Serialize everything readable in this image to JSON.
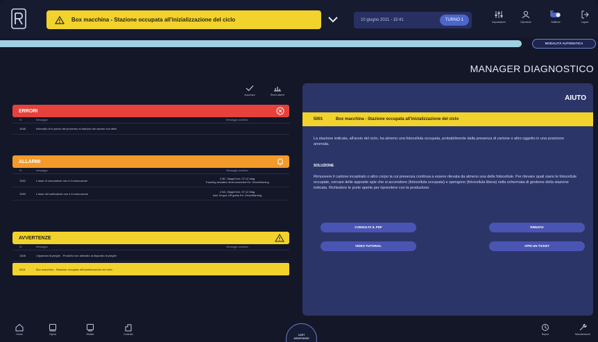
{
  "header": {
    "alert": "Box macchina - Stazione occupata all'inizializzazione del ciclo",
    "date": "10 giugno 2021 - 15:41",
    "shift": "TURNO 1",
    "icons": [
      {
        "label": "Impostazioni",
        "icon": "settings-sliders-icon"
      },
      {
        "label": "Operatore",
        "icon": "user-icon"
      },
      {
        "label": "Notifiche",
        "icon": "notification-toggle-icon"
      },
      {
        "label": "Logout",
        "icon": "logout-icon"
      }
    ]
  },
  "mode_button": "MODALITÀ AUTOMATICA",
  "page_title": "MANAGER DIAGNOSTICO",
  "toolbar": {
    "acknowledge": "Acquisisci",
    "reset": "Reset allarmi"
  },
  "columns": {
    "id": "ID",
    "message": "Messaggio",
    "component": "Messaggio ausiliario"
  },
  "errors": {
    "title": "ERRORI",
    "color": "#e6413a",
    "rows": [
      {
        "id": "1548",
        "message": "Intervallo di lo pezzo del prossimo al trascina nel cartoni non attivi",
        "component": ""
      }
    ]
  },
  "alarms": {
    "title": "ALLARMI",
    "color": "#f39a2a",
    "rows": [
      {
        "id": "1552",
        "message": "L'asse di convoiatore non è in esecuzione",
        "component": "2.9E, StageOver, 07:12 Mag\nTracking deviation limit exceeded Err. DriveWarning"
      },
      {
        "id": "1583",
        "message": "L'asse del sollevatore non è in esecuzione",
        "component": "2.9A, StageOver, 07:12 Mag\nAxis Torque Off guida Err. DriveWarning"
      }
    ]
  },
  "warnings": {
    "title": "AVVERTENZE",
    "color": "#f2d22c",
    "rows": [
      {
        "id": "1548",
        "message": "Cilpamani di pieghe - Prodotto non allineato al disposito di pieghe",
        "component": ""
      },
      {
        "id": "5001",
        "message": "Box macchina - Stazione occupata all'inizializzazione del ciclo",
        "component": "",
        "selected": true
      }
    ]
  },
  "help": {
    "title": "AIUTO",
    "code": "5001",
    "message": "Box macchina - Stazione occupata all'inizializzazione del ciclo",
    "description": "La stazione indicata, all'avvio del ciclo, ha almeno una fotocellula occupata, probabilmente dalla presenza di cartone o altro oggetto in una posizione anomala.",
    "solution_label": "SOLUZIONE",
    "solution": "Rimuovere il cartone incastrato o altro corpo la cui presenza continua a essere rilevata da almeno una delle fotocellule. Per rilevare quali siano le fotocellule occupate, cercare delle apposite spie che si accendono (fotocellula occupata) e spengono (fotocellula libera) nella schermata di gestione della stazione indicata. Richiudere le porte aperte per riprendere con la produzione.",
    "buttons": {
      "pdf": "CONSULTA IL PDF",
      "video": "VIDEO TUTORIAL",
      "more": "RIMUOVI",
      "ticket": "APRI UN TICKET"
    }
  },
  "bottom_nav": [
    {
      "label": "Home",
      "icon": "home-icon"
    },
    {
      "label": "Opera",
      "icon": "operations-icon"
    },
    {
      "label": "Ricette",
      "icon": "recipe-icon"
    },
    {
      "label": "Controllo",
      "icon": "control-icon"
    }
  ],
  "center_button": {
    "line1": "CART",
    "line2": "ASSISTANCE"
  },
  "bottom_right": [
    {
      "label": "Report",
      "icon": "history-icon"
    },
    {
      "label": "Manutenzione",
      "icon": "wrench-icon"
    }
  ]
}
